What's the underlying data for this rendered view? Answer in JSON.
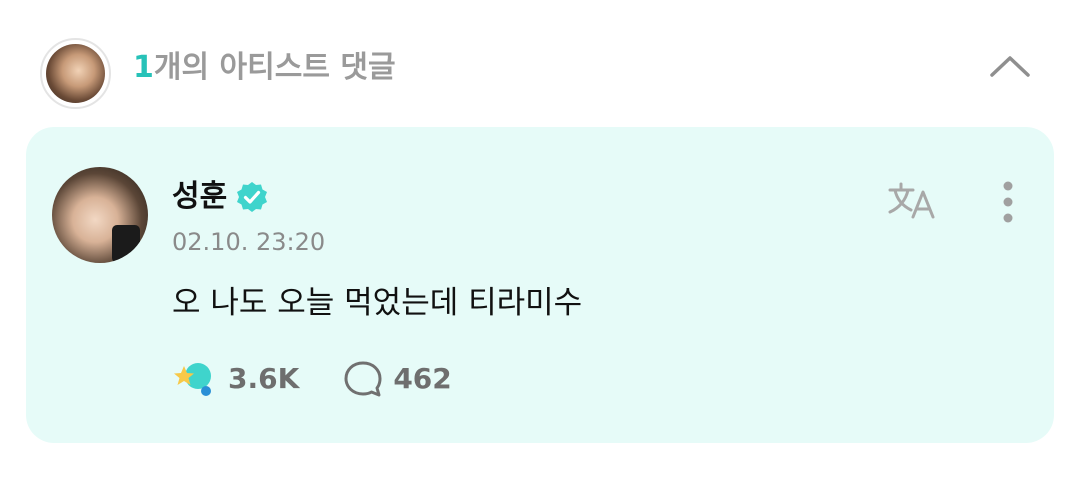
{
  "header": {
    "count": "1",
    "title": "개의 아티스트 댓글",
    "collapse_icon": "chevron-up-icon"
  },
  "comment": {
    "author": "성훈",
    "verified_icon": "verified-badge-icon",
    "timestamp": "02.10. 23:20",
    "text": "오 나도 오늘 먹었는데 티라미수",
    "likes": "3.6K",
    "replies": "462",
    "translate_icon": "translate-icon",
    "more_icon": "more-vertical-icon",
    "like_icon": "cheer-icon",
    "reply_icon": "speech-bubble-icon"
  },
  "colors": {
    "accent": "#27c2b8",
    "card_bg": "#e6fbf8",
    "muted_text": "#9a9a9a"
  }
}
